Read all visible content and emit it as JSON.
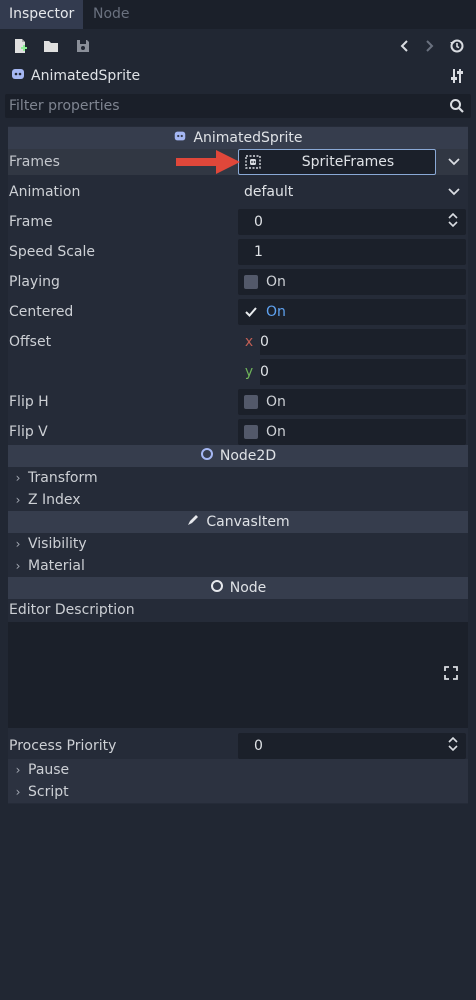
{
  "tabs": [
    {
      "label": "Inspector",
      "active": true
    },
    {
      "label": "Node",
      "active": false
    }
  ],
  "toolbar": {
    "icons": [
      "new-resource-icon",
      "open-resource-icon",
      "save-resource-icon",
      "history-back-icon",
      "history-forward-icon",
      "history-icon"
    ]
  },
  "object_header": {
    "name": "AnimatedSprite",
    "icon": "animated-sprite-icon",
    "settings_icon": "object-settings-icon"
  },
  "filter": {
    "placeholder": "Filter properties",
    "icon": "search-icon"
  },
  "sections": {
    "animated_sprite": "AnimatedSprite",
    "node2d": "Node2D",
    "canvas_item": "CanvasItem",
    "node": "Node"
  },
  "properties": {
    "frames": {
      "label": "Frames",
      "value": "SpriteFrames"
    },
    "animation": {
      "label": "Animation",
      "value": "default"
    },
    "frame": {
      "label": "Frame",
      "value": "0"
    },
    "speed_scale": {
      "label": "Speed Scale",
      "value": "1"
    },
    "playing": {
      "label": "Playing",
      "value": "On",
      "checked": false
    },
    "centered": {
      "label": "Centered",
      "value": "On",
      "checked": true
    },
    "offset": {
      "label": "Offset",
      "x_label": "x",
      "x": "0",
      "y_label": "y",
      "y": "0"
    },
    "flip_h": {
      "label": "Flip H",
      "value": "On",
      "checked": false
    },
    "flip_v": {
      "label": "Flip V",
      "value": "On",
      "checked": false
    },
    "editor_description": {
      "label": "Editor Description",
      "value": ""
    },
    "process_priority": {
      "label": "Process Priority",
      "value": "0"
    }
  },
  "groups": {
    "transform": "Transform",
    "z_index": "Z Index",
    "visibility": "Visibility",
    "material": "Material",
    "pause": "Pause",
    "script": "Script"
  },
  "colors": {
    "accent_on": "#5fa2f0",
    "arrow": "#e0473a",
    "x_axis": "#c15f55",
    "y_axis": "#6fb35a"
  }
}
